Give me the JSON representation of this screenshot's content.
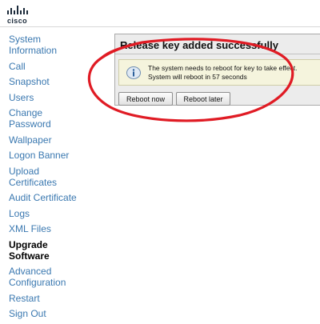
{
  "header": {
    "logo_text": "cisco",
    "logo_icon": "cisco-bars-icon"
  },
  "sidebar": {
    "items": [
      {
        "label": "System Information",
        "lines": [
          "System",
          "Information"
        ],
        "active": false
      },
      {
        "label": "Call",
        "lines": [
          "Call"
        ],
        "active": false
      },
      {
        "label": "Snapshot",
        "lines": [
          "Snapshot"
        ],
        "active": false
      },
      {
        "label": "Users",
        "lines": [
          "Users"
        ],
        "active": false
      },
      {
        "label": "Change Password",
        "lines": [
          "Change",
          "Password"
        ],
        "active": false
      },
      {
        "label": "Wallpaper",
        "lines": [
          "Wallpaper"
        ],
        "active": false
      },
      {
        "label": "Logon Banner",
        "lines": [
          "Logon Banner"
        ],
        "active": false
      },
      {
        "label": "Upload Certificates",
        "lines": [
          "Upload",
          "Certificates"
        ],
        "active": false
      },
      {
        "label": "Audit Certificate",
        "lines": [
          "Audit Certificate"
        ],
        "active": false
      },
      {
        "label": "Logs",
        "lines": [
          "Logs"
        ],
        "active": false
      },
      {
        "label": "XML Files",
        "lines": [
          "XML Files"
        ],
        "active": false
      },
      {
        "label": "Upgrade Software",
        "lines": [
          "Upgrade",
          "Software"
        ],
        "active": true
      },
      {
        "label": "Advanced Configuration",
        "lines": [
          "Advanced",
          "Configuration"
        ],
        "active": false
      },
      {
        "label": "Restart",
        "lines": [
          "Restart"
        ],
        "active": false
      },
      {
        "label": "Sign Out",
        "lines": [
          "Sign Out"
        ],
        "active": false
      }
    ]
  },
  "panel": {
    "title": "Release key added successfully",
    "info": {
      "icon": "info-icon",
      "line1": "The system needs to reboot for key to take effect.",
      "line2": "System will reboot in 57 seconds"
    },
    "buttons": {
      "reboot_now": "Reboot now",
      "reboot_later": "Reboot later"
    }
  },
  "colors": {
    "nav_link": "#3a78b0",
    "nav_active": "#000000",
    "annotation_circle": "#e01b24",
    "info_background": "#f5f4dd",
    "panel_background": "#ececec"
  }
}
